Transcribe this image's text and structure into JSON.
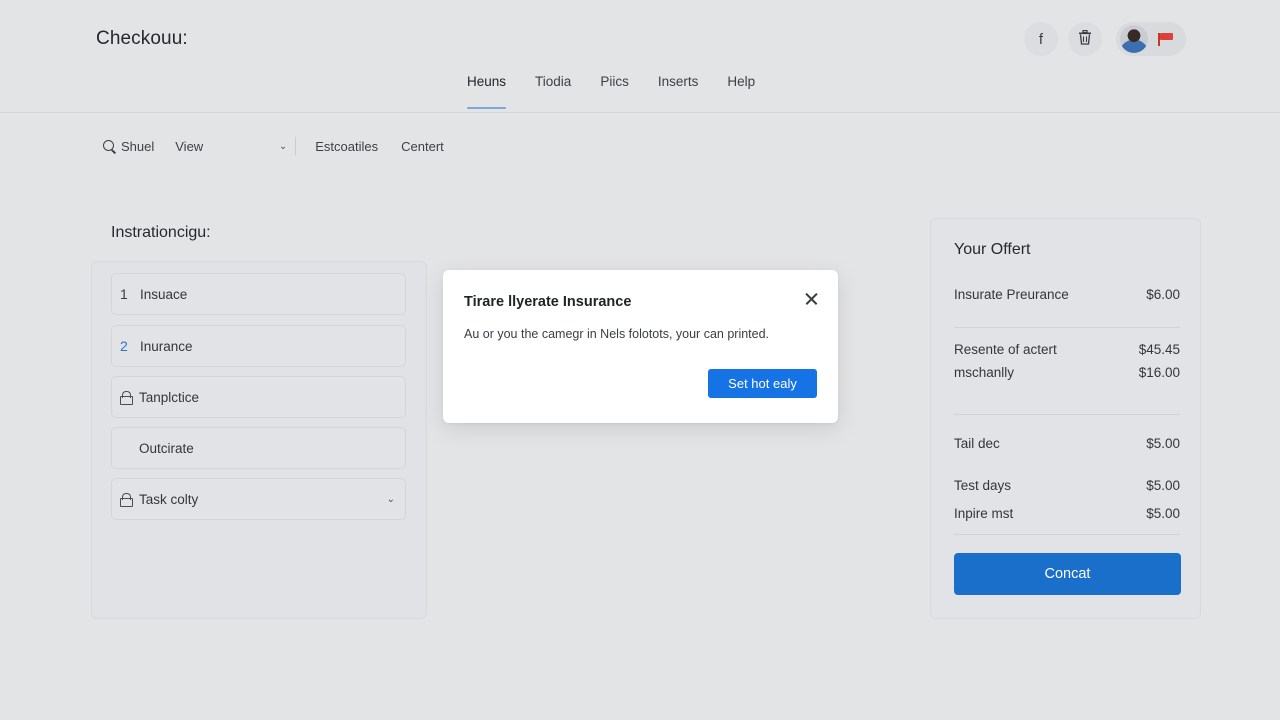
{
  "header": {
    "title": "Checkouu:",
    "actions": [
      {
        "icon": "facebook-icon",
        "glyph": "f"
      },
      {
        "icon": "trash-icon",
        "glyph": "🗑"
      }
    ]
  },
  "tabs": [
    {
      "label": "Heuns",
      "active": true
    },
    {
      "label": "Tiodia",
      "active": false
    },
    {
      "label": "Piics",
      "active": false
    },
    {
      "label": "Inserts",
      "active": false
    },
    {
      "label": "Help",
      "active": false
    }
  ],
  "toolbar": {
    "search_label": "Shuel",
    "view_label": "View",
    "links": [
      "Estcoatiles",
      "Centert"
    ]
  },
  "steps": {
    "title": "Instrationcigu:",
    "items": [
      {
        "marker": "1",
        "label": "Insuace"
      },
      {
        "marker": "2",
        "label": "Inurance"
      },
      {
        "marker": "lock",
        "label": "Tanplctice"
      },
      {
        "marker": "",
        "label": "Outcirate"
      },
      {
        "marker": "lock",
        "label": "Task colty"
      }
    ]
  },
  "offer": {
    "title": "Your Offert",
    "lines": [
      {
        "label": "Insurate Preurance",
        "value": "$6.00"
      },
      {
        "label": "Resente of actert",
        "value": "$45.45"
      },
      {
        "label": "mschanlly",
        "value": "$16.00"
      },
      {
        "label": "Tail dec",
        "value": "$5.00"
      },
      {
        "label": "Test days",
        "value": "$5.00"
      },
      {
        "label": "Inpire mst",
        "value": "$5.00"
      }
    ],
    "button_label": "Concat"
  },
  "dialog": {
    "title": "Tirare llyerate Insurance",
    "body": "Au or you the camegr in Nels folotots, your can printed.",
    "button_label": "Set hot ealy"
  },
  "colors": {
    "accent": "#1a6fca",
    "dialog_button": "#1573e6",
    "background": "#e3e4e6"
  }
}
